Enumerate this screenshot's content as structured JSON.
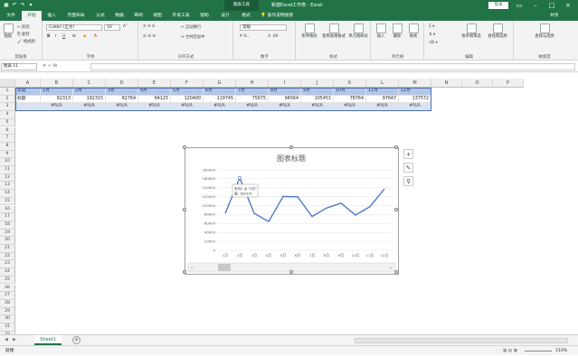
{
  "titlebar": {
    "context_tab": "图表工具",
    "title": "新建Excel工作表 - Excel",
    "login": "登录"
  },
  "tabs": [
    {
      "label": "文件"
    },
    {
      "label": "开始"
    },
    {
      "label": "插入"
    },
    {
      "label": "页面布局"
    },
    {
      "label": "公式"
    },
    {
      "label": "数据"
    },
    {
      "label": "审阅"
    },
    {
      "label": "视图"
    },
    {
      "label": "开发工具"
    },
    {
      "label": "帮助"
    },
    {
      "label": "设计"
    },
    {
      "label": "格式"
    }
  ],
  "tell_me": "操作说明搜索",
  "share": "共享",
  "ribbon": {
    "clipboard": {
      "label": "剪贴板",
      "paste": "粘贴",
      "cut": "剪切",
      "copy": "复制",
      "format_painter": "格式刷"
    },
    "font": {
      "label": "字体",
      "font_name": "Calibri (正文)",
      "font_size": "10",
      "bold": "B",
      "italic": "I",
      "underline": "U"
    },
    "alignment": {
      "label": "对齐方式",
      "wrap": "自动换行",
      "merge": "合并后居中"
    },
    "number": {
      "label": "数字",
      "format": "常规"
    },
    "styles": {
      "label": "样式",
      "conditional": "条件格式",
      "table": "套用表格格式",
      "cell_styles": "单元格样式"
    },
    "cells": {
      "label": "单元格",
      "insert": "插入",
      "delete": "删除",
      "format": "格式"
    },
    "editing": {
      "label": "编辑",
      "sort": "排序和筛选",
      "find": "查找和选择"
    },
    "sensitivity": {
      "label": "敏感度",
      "find2": "查找与选择"
    }
  },
  "formula_bar": {
    "name_box": "图表 11",
    "fx": "fx"
  },
  "columns": [
    "A",
    "B",
    "C",
    "D",
    "E",
    "F",
    "G",
    "H",
    "I",
    "J",
    "K",
    "L",
    "M",
    "N",
    "O",
    "P"
  ],
  "rows": [
    "1",
    "2",
    "3",
    "4",
    "5",
    "6",
    "7",
    "8",
    "9",
    "10",
    "11",
    "12",
    "13",
    "14",
    "15",
    "16",
    "17",
    "18",
    "19",
    "20",
    "21",
    "22",
    "23",
    "24",
    "25",
    "26",
    "27",
    "28",
    "29",
    "30",
    "31",
    "32"
  ],
  "table": {
    "row1": [
      "年度",
      "1月",
      "2月",
      "3月",
      "4月",
      "5月",
      "6月",
      "7月",
      "8月",
      "9月",
      "10月",
      "11月",
      "12月"
    ],
    "row2": [
      "标题",
      "82313",
      "192315",
      "82764",
      "64125",
      "120400",
      "119745",
      "75675",
      "94564",
      "105451",
      "78764",
      "97647",
      "137572"
    ],
    "row3": [
      "",
      "#N/A",
      "#N/A",
      "#N/A",
      "#N/A",
      "#N/A",
      "#N/A",
      "#N/A",
      "#N/A",
      "#N/A",
      "#N/A",
      "#N/A",
      "#N/A"
    ]
  },
  "chart_data": {
    "type": "line",
    "title": "图表标题",
    "categories": [
      "1月",
      "2月",
      "3月",
      "4月",
      "5月",
      "6月",
      "7月",
      "8月",
      "9月",
      "10月",
      "11月",
      "12月"
    ],
    "series": [
      {
        "values": [
          82313,
          162315,
          82764,
          64125,
          120400,
          119745,
          75675,
          94564,
          105451,
          78764,
          97647,
          137572
        ]
      }
    ],
    "ylim": [
      0,
      180000
    ],
    "yticks": [
      "0",
      "20000",
      "40000",
      "60000",
      "80000",
      "100000",
      "120000",
      "140000",
      "160000",
      "180000"
    ],
    "tooltip": {
      "line1": "系列1 点 \"2月\"",
      "line2": "值: 162315"
    },
    "color": "#4472c4"
  },
  "sheet": {
    "tab": "Sheet1",
    "add": "+"
  },
  "status": {
    "left": "就绪",
    "zoom": "110%"
  }
}
